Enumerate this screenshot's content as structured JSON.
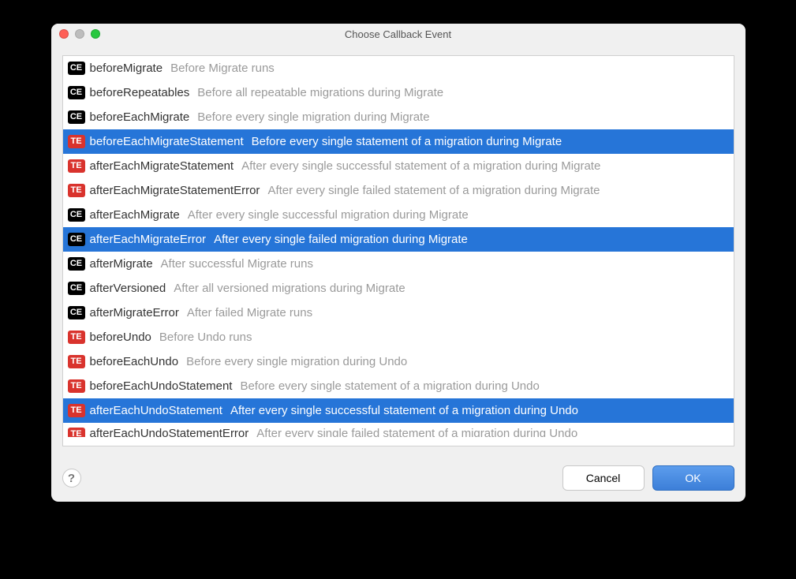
{
  "window": {
    "title": "Choose Callback Event"
  },
  "buttons": {
    "cancel": "Cancel",
    "ok": "OK",
    "help": "?"
  },
  "badge_labels": {
    "ce": "CE",
    "te": "TE"
  },
  "items": [
    {
      "badge": "ce",
      "name": "beforeMigrate",
      "desc": "Before Migrate runs",
      "selected": false
    },
    {
      "badge": "ce",
      "name": "beforeRepeatables",
      "desc": "Before all repeatable migrations during Migrate",
      "selected": false
    },
    {
      "badge": "ce",
      "name": "beforeEachMigrate",
      "desc": "Before every single migration during Migrate",
      "selected": false
    },
    {
      "badge": "te",
      "name": "beforeEachMigrateStatement",
      "desc": "Before every single statement of a migration during Migrate",
      "selected": true
    },
    {
      "badge": "te",
      "name": "afterEachMigrateStatement",
      "desc": "After every single successful statement of a migration during Migrate",
      "selected": false
    },
    {
      "badge": "te",
      "name": "afterEachMigrateStatementError",
      "desc": "After every single failed statement of a migration during Migrate",
      "selected": false
    },
    {
      "badge": "ce",
      "name": "afterEachMigrate",
      "desc": "After every single successful migration during Migrate",
      "selected": false
    },
    {
      "badge": "ce",
      "name": "afterEachMigrateError",
      "desc": "After every single failed migration during Migrate",
      "selected": true
    },
    {
      "badge": "ce",
      "name": "afterMigrate",
      "desc": "After successful Migrate runs",
      "selected": false
    },
    {
      "badge": "ce",
      "name": "afterVersioned",
      "desc": "After all versioned migrations during Migrate",
      "selected": false
    },
    {
      "badge": "ce",
      "name": "afterMigrateError",
      "desc": "After failed Migrate runs",
      "selected": false
    },
    {
      "badge": "te",
      "name": "beforeUndo",
      "desc": "Before Undo runs",
      "selected": false
    },
    {
      "badge": "te",
      "name": "beforeEachUndo",
      "desc": "Before every single migration during Undo",
      "selected": false
    },
    {
      "badge": "te",
      "name": "beforeEachUndoStatement",
      "desc": "Before every single statement of a migration during Undo",
      "selected": false
    },
    {
      "badge": "te",
      "name": "afterEachUndoStatement",
      "desc": "After every single successful statement of a migration during Undo",
      "selected": true
    },
    {
      "badge": "te",
      "name": "afterEachUndoStatementError",
      "desc": "After every single failed statement of a migration during Undo",
      "selected": false,
      "cut": true
    }
  ]
}
